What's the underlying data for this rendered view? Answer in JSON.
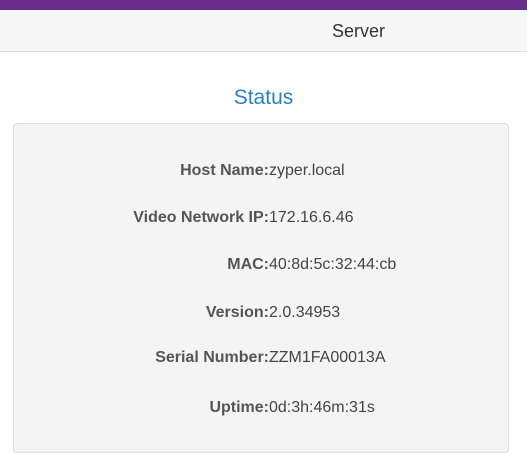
{
  "header": {
    "title": "Server"
  },
  "status": {
    "title": "Status",
    "rows": [
      {
        "label": "Host Name:",
        "value": "zyper.local"
      },
      {
        "label": "Video Network IP:",
        "value": "172.16.6.46"
      },
      {
        "label": "MAC:",
        "value": "40:8d:5c:32:44:cb"
      },
      {
        "label": "Version:",
        "value": "2.0.34953"
      },
      {
        "label": "Serial Number:",
        "value": "ZZM1FA00013A"
      },
      {
        "label": "Uptime:",
        "value": "0d:3h:46m:31s"
      }
    ]
  },
  "colors": {
    "top_bar": "#6a2d8e",
    "section_title": "#2a7fc4"
  }
}
